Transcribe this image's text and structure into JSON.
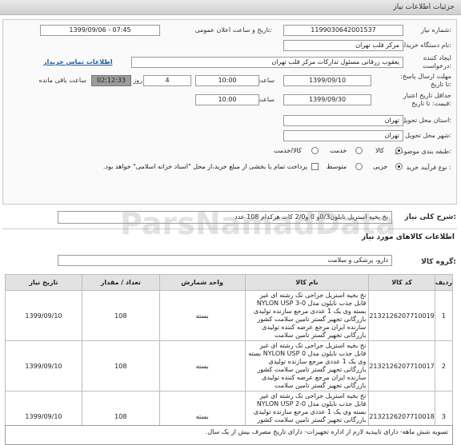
{
  "window_title": "جزئیات اطلاعات نیاز",
  "form": {
    "need_number_label": "شماره نیاز:",
    "need_number": "1199030642001537",
    "announce_label": "تاریخ و ساعت اعلان عمومی:",
    "announce_value": "1399/09/06 - 07:45",
    "buyer_label": "نام دستگاه خریدار:",
    "buyer_value": "مرکز قلب تهران",
    "creator_label": "ایجاد کننده درخواست:",
    "creator_value": "یعقوب زرقانی مسئول تدارکات مرکز قلب تهران",
    "contact_link": "اطلاعات تماس خریدار",
    "deadline_label": "مهلت ارسال پاسخ: تا تاریخ:",
    "deadline_date": "1399/09/10",
    "time_label": "ساعت",
    "deadline_time": "10:00",
    "days_value": "4",
    "days_label": "روز و",
    "remaining_time": "02:12:33",
    "remaining_label": "ساعت باقی مانده",
    "validity_label": "حداقل تاریخ اعتبار قیمت: تا تاریخ:",
    "validity_date": "1399/09/30",
    "validity_time": "10:00",
    "province_label": "استان محل تحویل:",
    "province_value": "تهران",
    "city_label": "شهر محل تحویل:",
    "city_value": "تهران",
    "category_label": "طبقه بندی موضوعی:",
    "category_options": [
      "کالا",
      "خدمت",
      "کالا/خدمت"
    ],
    "process_label": "نوع فرآیند خرید :",
    "process_options": [
      "جزیی",
      "متوسط"
    ],
    "payment_note": "پرداخت تمام یا بخشی از مبلغ خرید،از محل \"اسناد خزانه اسلامی\" خواهد بود."
  },
  "summary": {
    "label": "شرح کلی نیاز:",
    "value": "نخ بخیه استریل نایلون0/3و 0 و2/0 کات هرکدام 108 عدد"
  },
  "goods_section_title": "اطلاعات کالاهای مورد نیاز",
  "group": {
    "label": "گروه کالا:",
    "value": "دارو، پزشکی و سلامت"
  },
  "table": {
    "headers": [
      "ردیف",
      "کد کالا",
      "نام کالا",
      "واحد شمارش",
      "تعداد / مقدار",
      "تاریخ نیاز"
    ],
    "rows": [
      {
        "row": "1",
        "code": "2132126207710019",
        "name": "نخ بخیه استریل جراحی تک رشته ای غیر قابل جذب نایلون مدل 0-3 NYLON USP بسته وی یک 1 عددی مرجع سازنده تولیدی بازرگانی تجهیز گستر تامین سلامت کشور سازنده ایران مرجع عرضه کننده تولیدی بازرگانی تجهیز گستر تامین سلامت",
        "unit": "بسته",
        "qty": "108",
        "date": "1399/09/10"
      },
      {
        "row": "2",
        "code": "2132126207710017",
        "name": "نخ بخیه استریل جراحی تک رشته ای غیر قابل جذب نایلون مدل 0 NYLON USP بسته وی یک 1 عددی مرجع سازنده تولیدی بازرگانی تجهیز گستر تامین سلامت کشور سازنده ایران مرجع عرضه کننده تولیدی بازرگانی تجهیز گستر تامین سلامت",
        "unit": "بسته",
        "qty": "108",
        "date": "1399/09/10"
      },
      {
        "row": "3",
        "code": "2132126207710018",
        "name": "نخ بخیه استریل جراحی تک رشته ای غیر قابل جذب نایلون مدل 0-2 NYLON USP بسته وی یک 1 عددی مرجع سازنده تولیدی بازرگانی تجهیز گستر تامین سلامت کشور سازنده ایران مرجع عرضه کننده تولیدی بازرگانی تجهیز گستر تامین سلامت",
        "unit": "بسته",
        "qty": "108",
        "date": "1399/09/10"
      }
    ]
  },
  "footer_note": "تسویه شش ماهه- دارای تاییدیه لازم از اداره تجهیزات- دارای تاریخ مصرف بیش از یک سال.",
  "watermark": "ParsNamadData",
  "colors": {
    "link": "#1a5fb4",
    "header_bg": "#e2e2e2",
    "remaining_bg": "#9c9c9c"
  }
}
